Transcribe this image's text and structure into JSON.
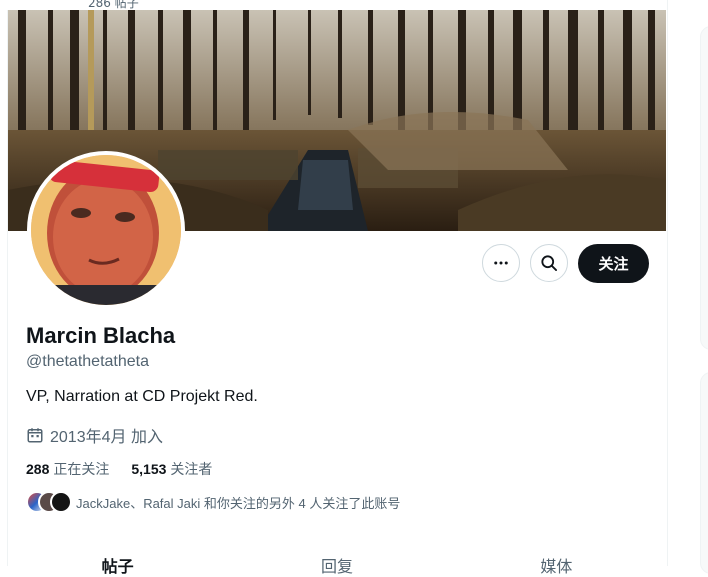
{
  "top_strip": {
    "text": "286 帖子"
  },
  "profile": {
    "name": "Marcin Blacha",
    "handle": "@thetathetatheta",
    "bio": "VP, Narration at CD Projekt Red.",
    "joined": "2013年4月 加入"
  },
  "actions": {
    "more_icon": "more-horizontal-icon",
    "search_icon": "search-icon",
    "follow_label": "关注"
  },
  "stats": {
    "following_count": "288",
    "following_label": "正在关注",
    "followers_count": "5,153",
    "followers_label": "关注者"
  },
  "followed_by": "JackJake、Rafal Jaki 和你关注的另外 4 人关注了此账号",
  "tabs": [
    {
      "label": "帖子",
      "active": true
    },
    {
      "label": "回复",
      "active": false
    },
    {
      "label": "媒体",
      "active": false
    }
  ],
  "colors": {
    "primary_text": "#0f1419",
    "secondary_text": "#536471",
    "follow_bg": "#0f1419",
    "border": "#cfd9de"
  }
}
